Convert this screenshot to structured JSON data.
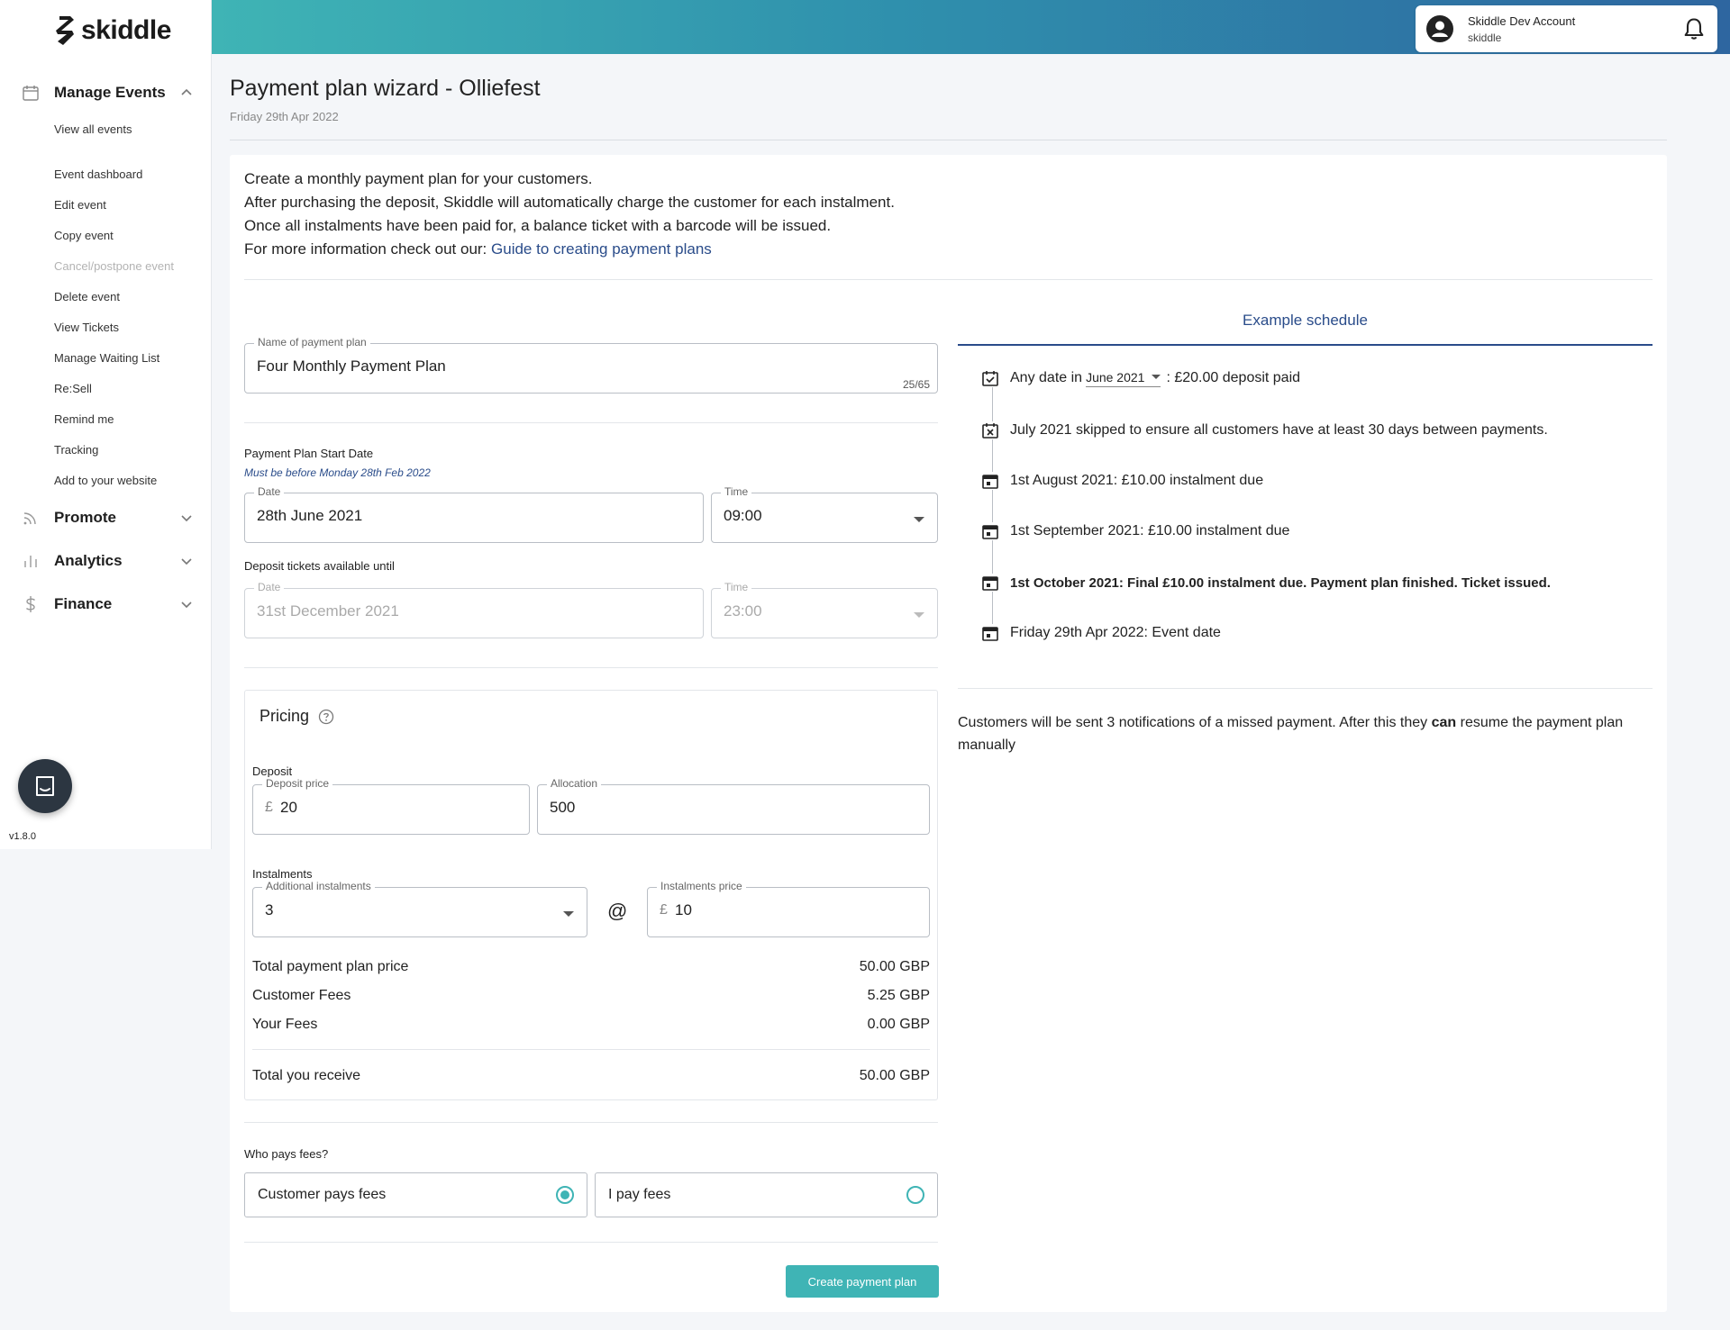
{
  "app": {
    "brand": "skiddle",
    "version": "v1.8.0"
  },
  "account": {
    "name": "Skiddle Dev Account",
    "username": "skiddle"
  },
  "sidebar": {
    "sections": [
      {
        "label": "Manage Events",
        "icon": "calendar-icon",
        "expanded": true
      },
      {
        "label": "Promote",
        "icon": "rss-icon",
        "expanded": false
      },
      {
        "label": "Analytics",
        "icon": "bar-chart-icon",
        "expanded": false
      },
      {
        "label": "Finance",
        "icon": "dollar-icon",
        "expanded": false
      }
    ],
    "manage_items": [
      {
        "label": "View all events",
        "disabled": false
      },
      {
        "label": "Event dashboard",
        "disabled": false
      },
      {
        "label": "Edit event",
        "disabled": false
      },
      {
        "label": "Copy event",
        "disabled": false
      },
      {
        "label": "Cancel/postpone event",
        "disabled": true
      },
      {
        "label": "Delete event",
        "disabled": false
      },
      {
        "label": "View Tickets",
        "disabled": false
      },
      {
        "label": "Manage Waiting List",
        "disabled": false
      },
      {
        "label": "Re:Sell",
        "disabled": false
      },
      {
        "label": "Remind me",
        "disabled": false
      },
      {
        "label": "Tracking",
        "disabled": false
      },
      {
        "label": "Add to your website",
        "disabled": false
      }
    ]
  },
  "header": {
    "title": "Payment plan wizard - Olliefest",
    "date": "Friday 29th Apr 2022"
  },
  "intro": {
    "line1": "Create a monthly payment plan for your customers.",
    "line2": "After purchasing the deposit, Skiddle will automatically charge the customer for each instalment.",
    "line3": "Once all instalments have been paid for, a balance ticket with a barcode will be issued.",
    "line4_prefix": "For more information check out our:",
    "guide_link": "Guide to creating payment plans"
  },
  "form": {
    "plan_name": {
      "label": "Name of payment plan",
      "value": "Four Monthly Payment Plan",
      "counter": "25/65"
    },
    "start": {
      "section_label": "Payment Plan Start Date",
      "hint": "Must be before Monday 28th Feb 2022",
      "date_label": "Date",
      "date_value": "28th June 2021",
      "time_label": "Time",
      "time_value": "09:00"
    },
    "deposit_until": {
      "section_label": "Deposit tickets available until",
      "date_label": "Date",
      "date_value": "31st December 2021",
      "time_label": "Time",
      "time_value": "23:00"
    },
    "pricing": {
      "title": "Pricing",
      "deposit_label": "Deposit",
      "deposit_price_label": "Deposit price",
      "deposit_price": "20",
      "allocation_label": "Allocation",
      "allocation": "500",
      "instalments_label": "Instalments",
      "additional_label": "Additional instalments",
      "additional": "3",
      "at": "@",
      "instalment_price_label": "Instalments price",
      "instalment_price": "10",
      "currency": "£",
      "rows": [
        {
          "label": "Total payment plan price",
          "value": "50.00 GBP"
        },
        {
          "label": "Customer Fees",
          "value": "5.25 GBP"
        },
        {
          "label": "Your Fees",
          "value": "0.00 GBP"
        }
      ],
      "total": {
        "label": "Total you receive",
        "value": "50.00 GBP"
      }
    },
    "fees": {
      "question": "Who pays fees?",
      "options": [
        {
          "label": "Customer pays fees",
          "selected": true
        },
        {
          "label": "I pay fees",
          "selected": false
        }
      ]
    },
    "submit_label": "Create payment plan"
  },
  "schedule": {
    "title": "Example schedule",
    "first": {
      "prefix": "Any date in",
      "month": "June 2021",
      "suffix": ": £20.00 deposit paid"
    },
    "items": [
      {
        "text": "July 2021 skipped to ensure all customers have at least 30 days between payments.",
        "icon": "calendar-x-icon",
        "bold": false
      },
      {
        "text": "1st August 2021: £10.00 instalment due",
        "icon": "calendar-icon",
        "bold": false
      },
      {
        "text": "1st September 2021: £10.00 instalment due",
        "icon": "calendar-icon",
        "bold": false
      },
      {
        "text": "1st October 2021: Final £10.00 instalment due. Payment plan finished. Ticket issued.",
        "icon": "calendar-icon",
        "bold": true
      },
      {
        "text": "Friday 29th Apr 2022: Event date",
        "icon": "calendar-icon",
        "bold": false
      }
    ],
    "note_prefix": "Customers will be sent 3 notifications of a missed payment. After this they",
    "note_bold": "can",
    "note_suffix": "resume the payment plan manually"
  },
  "colors": {
    "accent": "#3fb4b5",
    "link": "#2a4c8a",
    "gradient_start": "#3fb4b5",
    "gradient_end": "#2e66a0"
  }
}
